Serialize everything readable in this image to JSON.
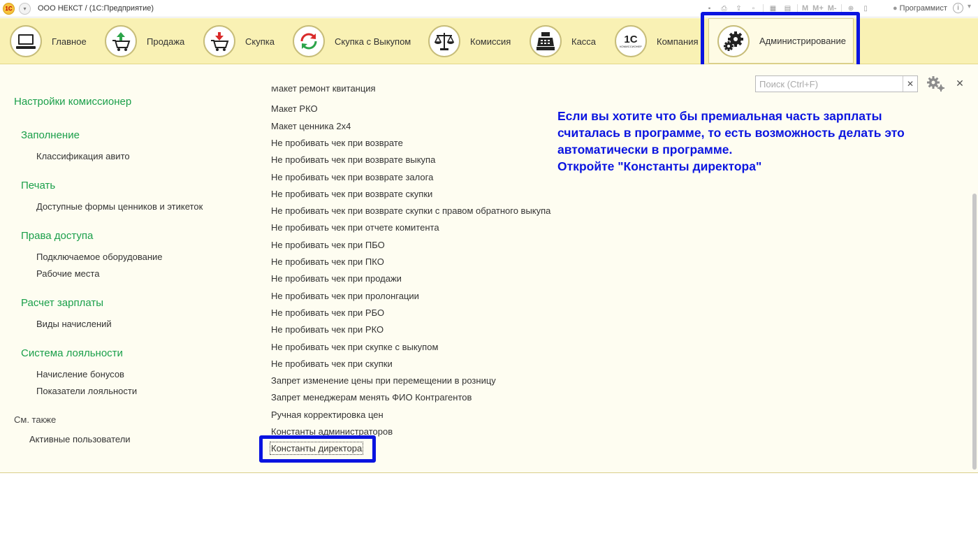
{
  "titlebar": {
    "logo_text": "1С",
    "title": "ООО НЕКСТ /   (1С:Предприятие)",
    "tool_text": [
      "M",
      "M+",
      "M-"
    ],
    "user": "Программист"
  },
  "sections": [
    {
      "label": "Главное",
      "icon": "computer-icon"
    },
    {
      "label": "Продажа",
      "icon": "cart-arrow-up-icon"
    },
    {
      "label": "Скупка",
      "icon": "cart-arrow-down-icon"
    },
    {
      "label": "Скупка с Выкупом",
      "icon": "recycle-arrows-icon"
    },
    {
      "label": "Комиссия",
      "icon": "scales-icon"
    },
    {
      "label": "Касса",
      "icon": "cash-register-icon"
    },
    {
      "label": "Компания",
      "icon": "1c-company-icon",
      "icon_text": "1C",
      "icon_sub": "КОМИССИОНЕР"
    },
    {
      "label": "Администрирование",
      "icon": "gears-icon",
      "active": true
    }
  ],
  "search": {
    "placeholder": "Поиск (Ctrl+F)",
    "value": ""
  },
  "left_nav": {
    "title": "Настройки комиссионер",
    "groups": [
      {
        "header": "Заполнение",
        "items": [
          "Классификация авито"
        ]
      },
      {
        "header": "Печать",
        "items": [
          "Доступные формы ценников и этикеток"
        ]
      },
      {
        "header": "Права доступа",
        "items": [
          "Подключаемое оборудование",
          "Рабочие места"
        ]
      },
      {
        "header": "Расчет зарплаты",
        "items": [
          "Виды начислений"
        ]
      },
      {
        "header": "Система лояльности",
        "items": [
          "Начисление бонусов",
          "Показатели лояльности"
        ]
      }
    ],
    "see_also": {
      "label": "См. также",
      "items": [
        "Активные пользователи"
      ]
    }
  },
  "mid_list": {
    "partial_first": "Макет ремонт квитанция",
    "items": [
      "Макет РКО",
      "Макет ценника 2х4",
      "Не пробивать чек при возврате",
      "Не пробивать чек при возврате выкупа",
      "Не пробивать чек при возврате залога",
      "Не пробивать чек при возврате скупки",
      "Не пробивать чек при возврате скупки с правом обратного выкупа",
      "Не пробивать чек при отчете комитента",
      "Не пробивать чек при ПБО",
      "Не пробивать чек при ПКО",
      "Не пробивать чек при продажи",
      "Не пробивать чек при пролонгации",
      "Не пробивать чек при РБО",
      "Не пробивать чек при РКО",
      "Не пробивать чек при скупке с выкупом",
      "Не пробивать чек при скупки",
      "Запрет изменение цены при перемещении в розницу",
      "Запрет менеджерам менять ФИО Контрагентов",
      "Ручная корректировка цен",
      "Константы администраторов",
      "Константы директора"
    ]
  },
  "annotation": {
    "lines": [
      "Если вы хотите что бы премиальная часть зарплаты",
      "считалась в программе, то есть возможность делать это",
      "автоматически в программе.",
      "Откройте \"Константы директора\""
    ],
    "color": "#0a14e0"
  },
  "colors": {
    "section_bar": "#f9f1b4",
    "content_bg": "#fefdf1",
    "nav_header": "#1a9f4a",
    "highlight": "#0a14e0"
  }
}
